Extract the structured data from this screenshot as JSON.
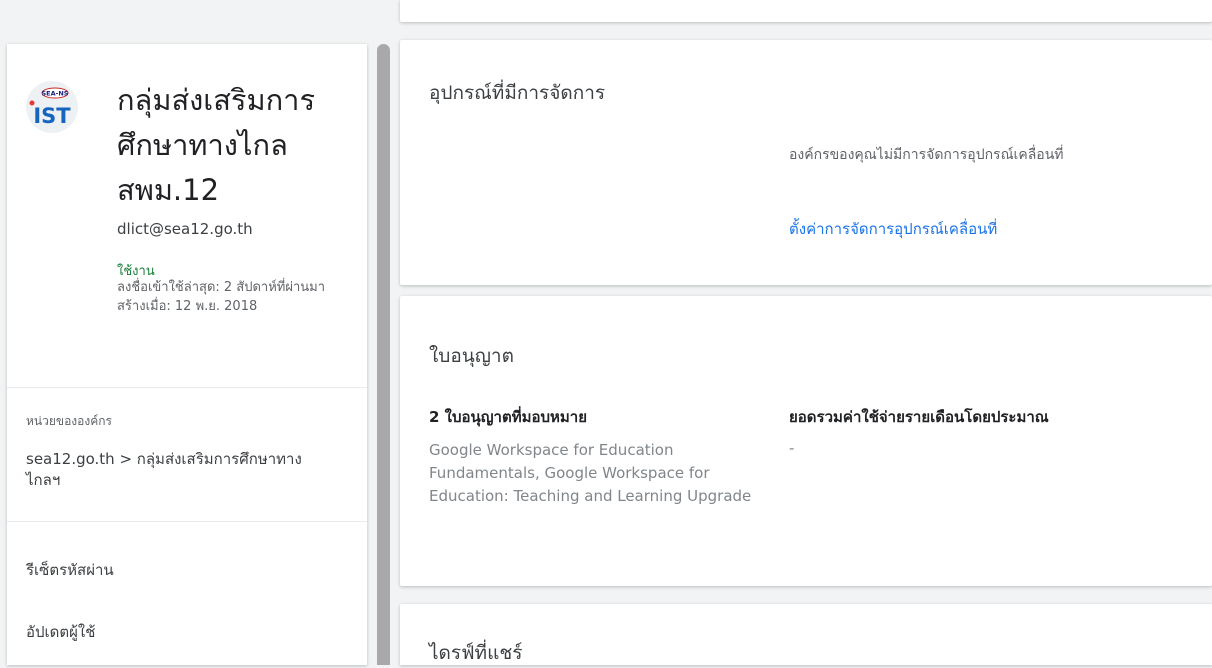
{
  "user": {
    "name": "กลุ่มส่งเสริมการศึกษาทางไกล สพม.12",
    "email": "dlict@sea12.go.th",
    "status": "ใช้งาน",
    "last_sign_in": "ลงชื่อเข้าใช้ล่าสุด: 2 สัปดาห์ที่ผ่านมา",
    "created": "สร้างเมื่อ: 12 พ.ย. 2018",
    "logo_text": "SEA-NS IST"
  },
  "org_unit": {
    "label": "หน่วยขององค์กร",
    "path": "sea12.go.th > กลุ่มส่งเสริมการศึกษาทางไกลฯ"
  },
  "actions": {
    "reset_password": "รีเซ็ตรหัสผ่าน",
    "update_user": "อัปเดตผู้ใช้"
  },
  "devices_card": {
    "title": "อุปกรณ์ที่มีการจัดการ",
    "message": "องค์กรของคุณไม่มีการจัดการอุปกรณ์เคลื่อนที่",
    "link": "ตั้งค่าการจัดการอุปกรณ์เคลื่อนที่"
  },
  "licenses_card": {
    "title": "ใบอนุญาต",
    "assigned_header": "2 ใบอนุญาตที่มอบหมาย",
    "assigned_detail": "Google Workspace for Education Fundamentals, Google Workspace for Education: Teaching and Learning Upgrade",
    "cost_header": "ยอดรวมค่าใช้จ่ายรายเดือนโดยประมาณ",
    "cost_value": "-"
  },
  "drives_card": {
    "title": "ไดรฟ์ที่แชร์"
  },
  "colors": {
    "status_active": "#188038",
    "link": "#1a73e8"
  }
}
